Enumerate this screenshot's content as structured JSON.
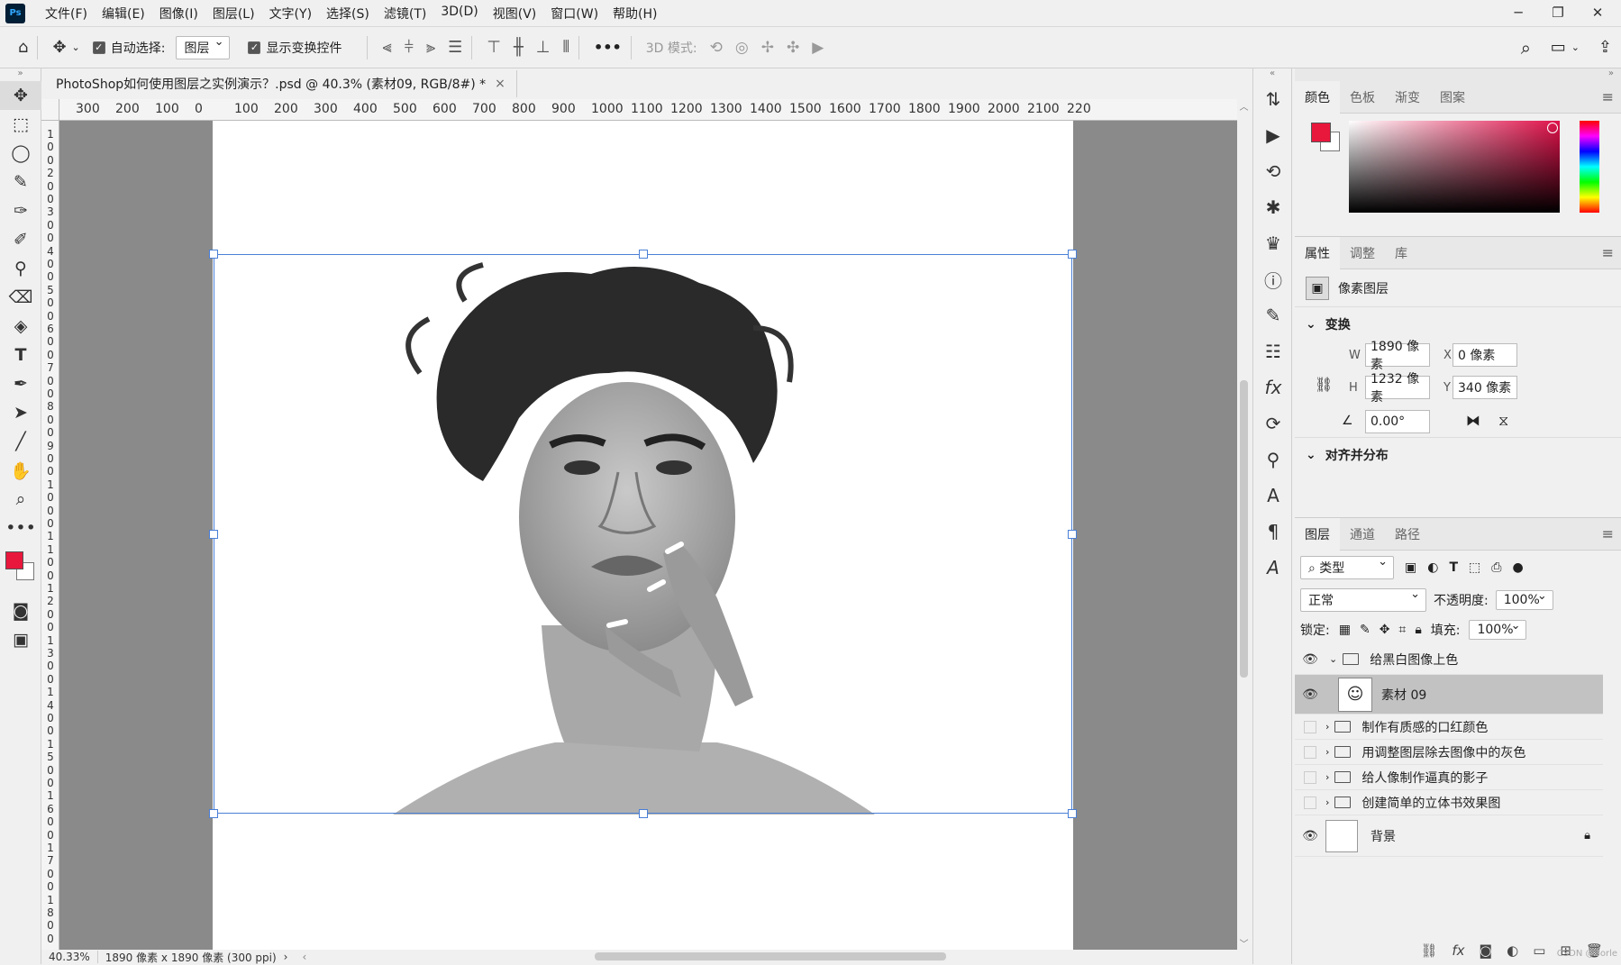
{
  "app": {
    "logo": "Ps"
  },
  "menu": [
    "文件(F)",
    "编辑(E)",
    "图像(I)",
    "图层(L)",
    "文字(Y)",
    "选择(S)",
    "滤镜(T)",
    "3D(D)",
    "视图(V)",
    "窗口(W)",
    "帮助(H)"
  ],
  "options": {
    "auto_select_label": "自动选择:",
    "auto_select_value": "图层",
    "show_transform_label": "显示变换控件",
    "mode3d_label": "3D 模式:",
    "more": "•••"
  },
  "document": {
    "tab_title": "PhotoShop如何使用图层之实例演示？.psd @ 40.3% (素材09, RGB/8#) *",
    "close": "×"
  },
  "ruler": {
    "h": [
      "300",
      "200",
      "100",
      "0",
      "100",
      "200",
      "300",
      "400",
      "500",
      "600",
      "700",
      "800",
      "900",
      "1000",
      "1100",
      "1200",
      "1300",
      "1400",
      "1500",
      "1600",
      "1700",
      "1800",
      "1900",
      "2000",
      "2100",
      "220"
    ],
    "v": [
      "1",
      "0",
      "0",
      "2",
      "0",
      "0",
      "3",
      "0",
      "0",
      "4",
      "0",
      "0",
      "5",
      "0",
      "0",
      "6",
      "0",
      "0",
      "7",
      "0",
      "0",
      "8",
      "0",
      "0",
      "9",
      "0",
      "0",
      "1",
      "0",
      "0",
      "0",
      "1",
      "1",
      "0",
      "0",
      "1",
      "2",
      "0",
      "0",
      "1",
      "3",
      "0",
      "0",
      "1",
      "4",
      "0",
      "0",
      "1",
      "5",
      "0",
      "0",
      "1",
      "6",
      "0",
      "0",
      "1",
      "7",
      "0",
      "0",
      "1",
      "8",
      "0",
      "0"
    ]
  },
  "status": {
    "zoom": "40.33%",
    "info": "1890 像素 x 1890 像素 (300 ppi)",
    "arrow": "›"
  },
  "color_panel": {
    "tabs": [
      "颜色",
      "色板",
      "渐变",
      "图案"
    ],
    "foreground": "#e8173c",
    "background": "#ffffff"
  },
  "properties": {
    "tabs": [
      "属性",
      "调整",
      "库"
    ],
    "layer_type": "像素图层",
    "transform_title": "变换",
    "w_label": "W",
    "w_value": "1890 像素",
    "h_label": "H",
    "h_value": "1232 像素",
    "x_label": "X",
    "x_value": "0 像素",
    "y_label": "Y",
    "y_value": "340 像素",
    "angle": "0.00°",
    "align_title": "对齐并分布"
  },
  "layers": {
    "tabs": [
      "图层",
      "通道",
      "路径"
    ],
    "filter": "类型",
    "blend": "正常",
    "opacity_label": "不透明度:",
    "opacity": "100%",
    "lock_label": "锁定:",
    "fill_label": "填充:",
    "fill": "100%",
    "items": [
      {
        "name": "给黑白图像上色",
        "type": "group",
        "visible": true,
        "open": true
      },
      {
        "name": "素材 09",
        "type": "layer",
        "visible": true,
        "selected": true
      },
      {
        "name": "制作有质感的口红颜色",
        "type": "group",
        "visible": false
      },
      {
        "name": "用调整图层除去图像中的灰色",
        "type": "group",
        "visible": false
      },
      {
        "name": "给人像制作逼真的影子",
        "type": "group",
        "visible": false
      },
      {
        "name": "创建简单的立体书效果图",
        "type": "group",
        "visible": false
      },
      {
        "name": "背景",
        "type": "background",
        "visible": true
      }
    ],
    "watermark": "CSDN @Sorle"
  }
}
